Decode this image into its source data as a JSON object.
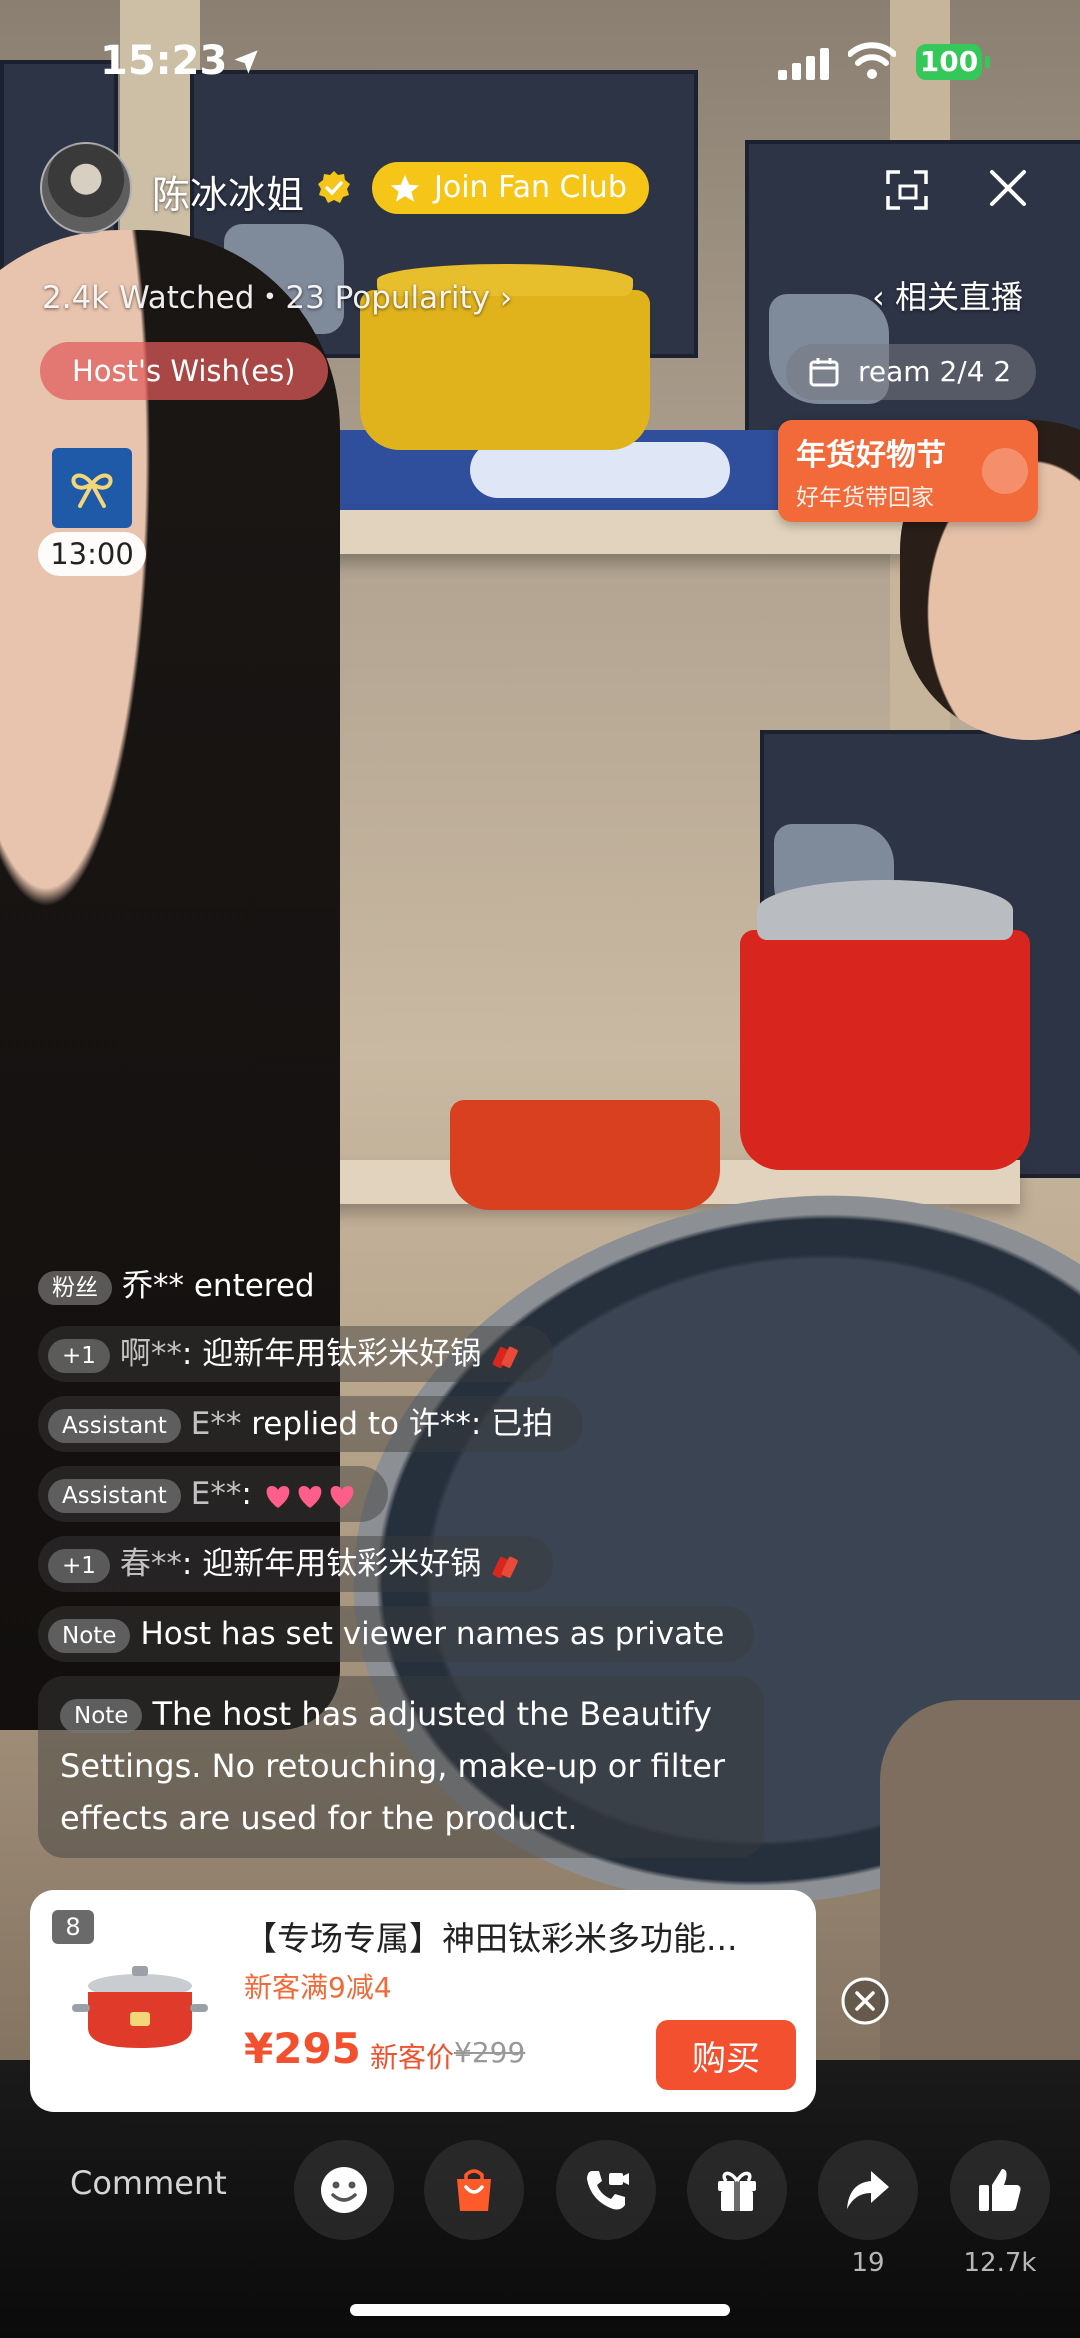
{
  "status_bar": {
    "time": "15:23",
    "battery": "100"
  },
  "host": {
    "name": "陈冰冰姐",
    "fan_club_label": "Join Fan Club",
    "watched": "2.4k Watched・23 Popularity",
    "related_label": "相关直播",
    "wish_label": "Host's Wish(es)",
    "stream_label": "ream 2/4 2"
  },
  "gift_timer": "13:00",
  "promo": {
    "title": "年货好物节",
    "subtitle": "好年货带回家",
    "accent": "#f26a3a"
  },
  "chat": [
    {
      "tag": "粉丝",
      "user": "",
      "text": "乔** entered"
    },
    {
      "tag": "+1",
      "user": "啊**",
      "text": ": 迎新年用钛彩米好锅"
    },
    {
      "tag": "Assistant",
      "user": "E**",
      "text": " replied to 许**: 已拍"
    },
    {
      "tag": "Assistant",
      "user": "E**",
      "text": ":"
    },
    {
      "tag": "+1",
      "user": "春**",
      "text": ": 迎新年用钛彩米好锅"
    },
    {
      "tag": "Note",
      "user": "",
      "text": "Host has set viewer names as private"
    },
    {
      "tag": "Note",
      "user": "",
      "text": "The host has adjusted the Beautify Settings. No retouching, make-up or filter effects are used for the product."
    }
  ],
  "product": {
    "rank": "8",
    "title": "【专场专属】神田钛彩米多功能...",
    "deal": "新客满9减4",
    "price": "¥295",
    "new_label": "新客价",
    "old_price": "¥299",
    "buy_label": "购买",
    "accent": "#f2502e"
  },
  "bottom_bar": {
    "comment_placeholder": "Comment",
    "share_count": "19",
    "like_count": "12.7k"
  }
}
